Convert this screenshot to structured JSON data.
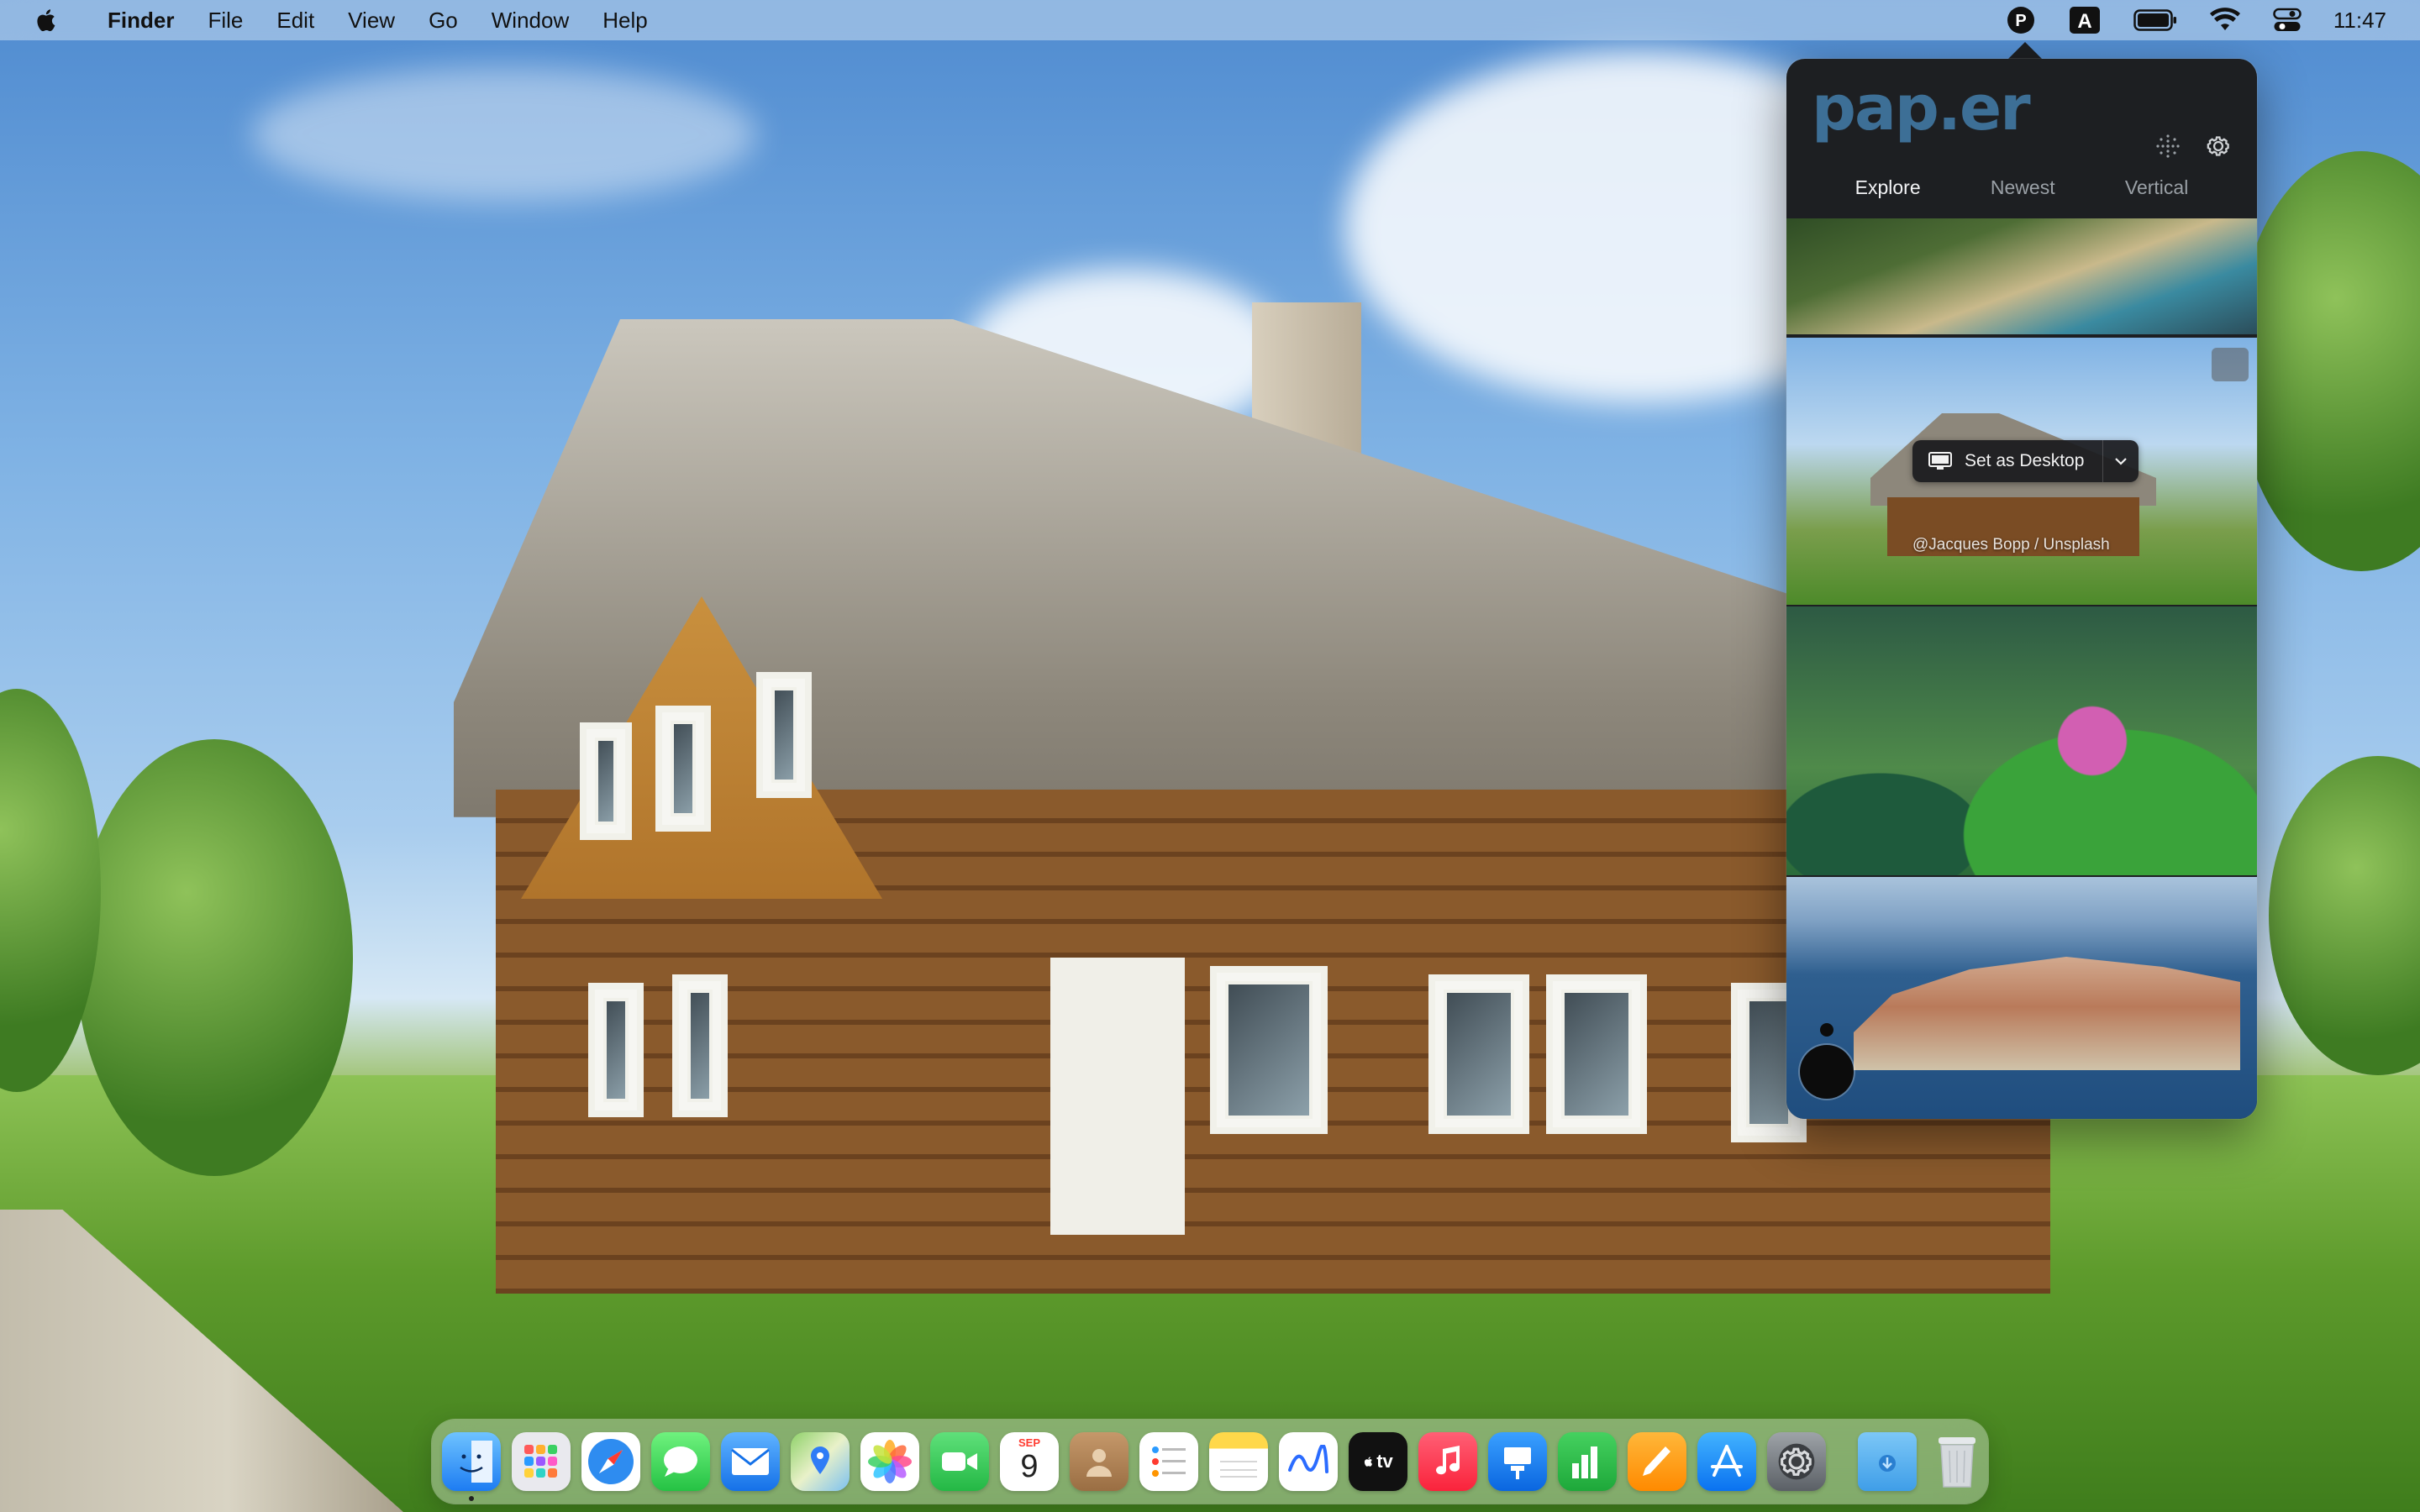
{
  "menubar": {
    "app_name": "Finder",
    "menus": [
      "File",
      "Edit",
      "View",
      "Go",
      "Window",
      "Help"
    ],
    "status": {
      "paper_icon_letter": "P",
      "input_source_letter": "A",
      "clock": "11:47"
    }
  },
  "paper_popover": {
    "logo": "pap.er",
    "tabs": [
      {
        "label": "Explore",
        "active": true
      },
      {
        "label": "Newest",
        "active": false
      },
      {
        "label": "Vertical",
        "active": false
      }
    ],
    "hover_card": {
      "set_desktop_label": "Set as Desktop",
      "credit": "@Jacques Bopp / Unsplash"
    }
  },
  "dock": {
    "calendar_month": "SEP",
    "calendar_day": "9",
    "apple_tv_label": "tv"
  }
}
